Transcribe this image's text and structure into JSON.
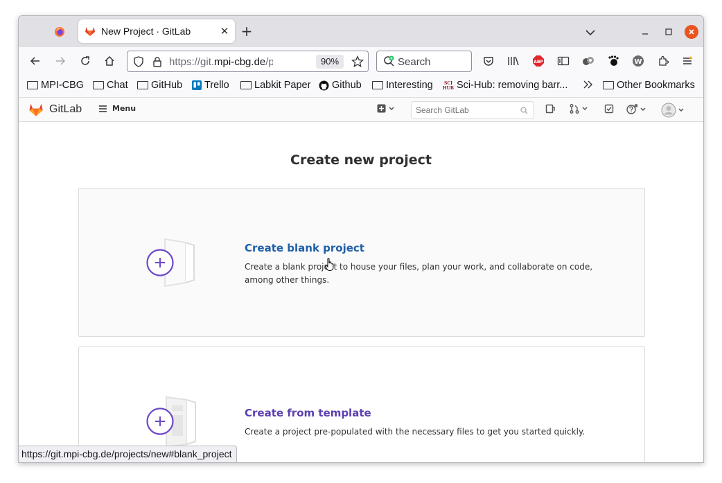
{
  "browser": {
    "tab_title": "New Project · GitLab",
    "url_host_prefix": "https://git.",
    "url_host": "mpi-cbg.de",
    "url_path": "/projects/new",
    "zoom": "90%",
    "search_placeholder": "Search",
    "status_url": "https://git.mpi-cbg.de/projects/new#blank_project"
  },
  "bookmarks": [
    {
      "label": "MPI-CBG",
      "icon": "folder-icon"
    },
    {
      "label": "Chat",
      "icon": "folder-icon"
    },
    {
      "label": "GitHub",
      "icon": "folder-icon"
    },
    {
      "label": "Trello",
      "icon": "trello-icon"
    },
    {
      "label": "Labkit Paper",
      "icon": "folder-icon"
    },
    {
      "label": "Github",
      "icon": "github-icon"
    },
    {
      "label": "Interesting",
      "icon": "folder-icon"
    },
    {
      "label": "Sci-Hub: removing barr...",
      "icon": "scihub-icon"
    },
    {
      "label": "Other Bookmarks",
      "icon": "folder-icon"
    }
  ],
  "scihub_logo_text": "SCI HUB",
  "gitlab": {
    "brand": "GitLab",
    "menu_label": "Menu",
    "search_placeholder": "Search GitLab"
  },
  "page": {
    "title": "Create new project",
    "cards": [
      {
        "title": "Create blank project",
        "description": "Create a blank project to house your files, plan your work, and collaborate on code, among other things."
      },
      {
        "title": "Create from template",
        "description": "Create a project pre-populated with the necessary files to get you started quickly."
      }
    ]
  },
  "colors": {
    "link_blue": "#1f5fa8",
    "purple": "#6e49cb",
    "close_orange": "#e95420"
  }
}
